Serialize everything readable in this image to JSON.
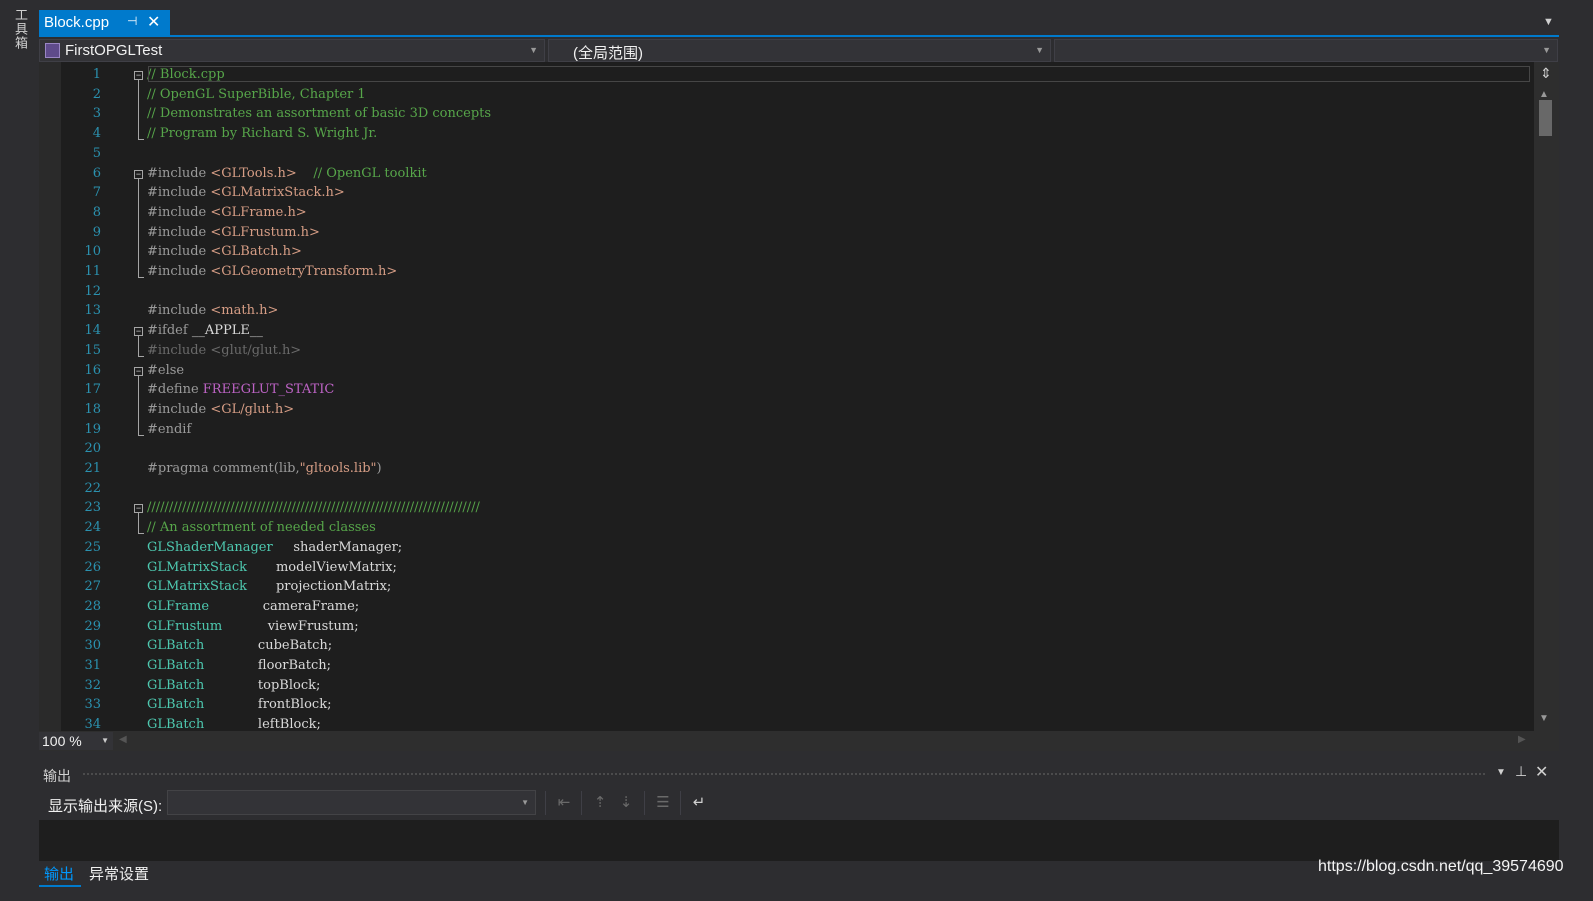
{
  "sidebar": {
    "toolbox_label": "工具箱"
  },
  "tab": {
    "title": "Block.cpp",
    "pin_glyph": "⊣",
    "close_glyph": "✕"
  },
  "navbar": {
    "project": "FirstOPGLTest",
    "scope": "(全局范围)",
    "member": ""
  },
  "editor": {
    "lines": [
      {
        "n": "1",
        "fold": "minus",
        "segs": [
          {
            "t": "// Block.cpp",
            "c": "cm"
          }
        ]
      },
      {
        "n": "2",
        "segs": [
          {
            "t": "// OpenGL SuperBible, Chapter 1",
            "c": "cm"
          }
        ]
      },
      {
        "n": "3",
        "segs": [
          {
            "t": "// Demonstrates an assortment of basic 3D concepts",
            "c": "cm"
          }
        ]
      },
      {
        "n": "4",
        "segs": [
          {
            "t": "// Program by Richard S. Wright Jr.",
            "c": "cm"
          }
        ]
      },
      {
        "n": "5",
        "segs": []
      },
      {
        "n": "6",
        "fold": "minus",
        "segs": [
          {
            "t": "#include ",
            "c": "pp"
          },
          {
            "t": "<GLTools.h>",
            "c": "inc"
          },
          {
            "t": "    ",
            "c": "id"
          },
          {
            "t": "// OpenGL toolkit",
            "c": "cm"
          }
        ]
      },
      {
        "n": "7",
        "segs": [
          {
            "t": "#include ",
            "c": "pp"
          },
          {
            "t": "<GLMatrixStack.h>",
            "c": "inc"
          }
        ]
      },
      {
        "n": "8",
        "segs": [
          {
            "t": "#include ",
            "c": "pp"
          },
          {
            "t": "<GLFrame.h>",
            "c": "inc"
          }
        ]
      },
      {
        "n": "9",
        "segs": [
          {
            "t": "#include ",
            "c": "pp"
          },
          {
            "t": "<GLFrustum.h>",
            "c": "inc"
          }
        ]
      },
      {
        "n": "10",
        "segs": [
          {
            "t": "#include ",
            "c": "pp"
          },
          {
            "t": "<GLBatch.h>",
            "c": "inc"
          }
        ]
      },
      {
        "n": "11",
        "segs": [
          {
            "t": "#include ",
            "c": "pp"
          },
          {
            "t": "<GLGeometryTransform.h>",
            "c": "inc"
          }
        ]
      },
      {
        "n": "12",
        "segs": []
      },
      {
        "n": "13",
        "segs": [
          {
            "t": "#include ",
            "c": "pp"
          },
          {
            "t": "<math.h>",
            "c": "inc"
          }
        ]
      },
      {
        "n": "14",
        "fold": "minus",
        "segs": [
          {
            "t": "#ifdef ",
            "c": "pp"
          },
          {
            "t": "__APPLE__",
            "c": "id"
          }
        ]
      },
      {
        "n": "15",
        "segs": [
          {
            "t": "#include <glut/glut.h>",
            "c": "dim"
          }
        ]
      },
      {
        "n": "16",
        "fold": "minus",
        "segs": [
          {
            "t": "#else",
            "c": "pp"
          }
        ]
      },
      {
        "n": "17",
        "segs": [
          {
            "t": "#define ",
            "c": "pp"
          },
          {
            "t": "FREEGLUT_STATIC",
            "c": "mc"
          }
        ]
      },
      {
        "n": "18",
        "segs": [
          {
            "t": "#include ",
            "c": "pp"
          },
          {
            "t": "<GL/glut.h>",
            "c": "inc"
          }
        ]
      },
      {
        "n": "19",
        "segs": [
          {
            "t": "#endif",
            "c": "pp"
          }
        ]
      },
      {
        "n": "20",
        "segs": []
      },
      {
        "n": "21",
        "segs": [
          {
            "t": "#pragma comment(lib,",
            "c": "pp"
          },
          {
            "t": "\"gltools.lib\"",
            "c": "str"
          },
          {
            "t": ")",
            "c": "pp"
          }
        ]
      },
      {
        "n": "22",
        "segs": []
      },
      {
        "n": "23",
        "fold": "minus",
        "segs": [
          {
            "t": "////////////////////////////////////////////////////////////////////////////",
            "c": "cm"
          }
        ]
      },
      {
        "n": "24",
        "segs": [
          {
            "t": "// An assortment of needed classes",
            "c": "cm"
          }
        ]
      },
      {
        "n": "25",
        "segs": [
          {
            "t": "GLShaderManager     ",
            "c": "tp"
          },
          {
            "t": "shaderManager;",
            "c": "id"
          }
        ]
      },
      {
        "n": "26",
        "segs": [
          {
            "t": "GLMatrixStack       ",
            "c": "tp"
          },
          {
            "t": "modelViewMatrix;",
            "c": "id"
          }
        ]
      },
      {
        "n": "27",
        "segs": [
          {
            "t": "GLMatrixStack       ",
            "c": "tp"
          },
          {
            "t": "projectionMatrix;",
            "c": "id"
          }
        ]
      },
      {
        "n": "28",
        "segs": [
          {
            "t": "GLFrame             ",
            "c": "tp"
          },
          {
            "t": "cameraFrame;",
            "c": "id"
          }
        ]
      },
      {
        "n": "29",
        "segs": [
          {
            "t": "GLFrustum           ",
            "c": "tp"
          },
          {
            "t": "viewFrustum;",
            "c": "id"
          }
        ]
      },
      {
        "n": "30",
        "segs": [
          {
            "t": "GLBatch             ",
            "c": "tp"
          },
          {
            "t": "cubeBatch;",
            "c": "id"
          }
        ]
      },
      {
        "n": "31",
        "segs": [
          {
            "t": "GLBatch             ",
            "c": "tp"
          },
          {
            "t": "floorBatch;",
            "c": "id"
          }
        ]
      },
      {
        "n": "32",
        "segs": [
          {
            "t": "GLBatch             ",
            "c": "tp"
          },
          {
            "t": "topBlock;",
            "c": "id"
          }
        ]
      },
      {
        "n": "33",
        "segs": [
          {
            "t": "GLBatch             ",
            "c": "tp"
          },
          {
            "t": "frontBlock;",
            "c": "id"
          }
        ]
      },
      {
        "n": "34",
        "segs": [
          {
            "t": "GLBatch             ",
            "c": "tp"
          },
          {
            "t": "leftBlock;",
            "c": "id"
          }
        ]
      }
    ]
  },
  "zoom": {
    "value": "100 %"
  },
  "output": {
    "title": "输出",
    "source_label": "显示输出来源(S):",
    "source_value": "",
    "toolbar_icons": [
      "goto-previous-message-icon",
      "goto-previous-icon",
      "goto-next-icon",
      "clear-all-icon",
      "toggle-word-wrap-icon"
    ]
  },
  "bottom_tabs": {
    "output": "输出",
    "exception_settings": "异常设置"
  },
  "watermark": "https://blog.csdn.net/qq_39574690",
  "colors": {
    "accent": "#007acc",
    "editor_bg": "#1e1e1e",
    "comment": "#57a64a",
    "type": "#4ec9b0",
    "macro": "#bd63c5",
    "include_path": "#d69d85",
    "line_number": "#2b91af"
  }
}
